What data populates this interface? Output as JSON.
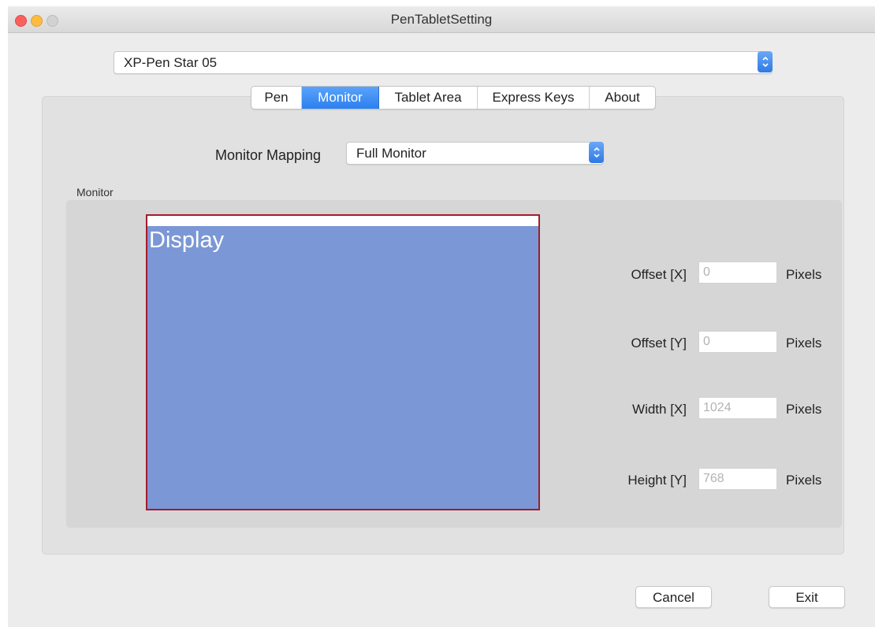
{
  "window": {
    "title": "PenTabletSetting"
  },
  "device": {
    "selected": "XP-Pen Star 05"
  },
  "tabs": [
    {
      "label": "Pen",
      "active": false
    },
    {
      "label": "Monitor",
      "active": true
    },
    {
      "label": "Tablet Area",
      "active": false
    },
    {
      "label": "Express Keys",
      "active": false
    },
    {
      "label": "About",
      "active": false
    }
  ],
  "monitor_mapping": {
    "label": "Monitor Mapping",
    "selected": "Full Monitor"
  },
  "monitor_group": {
    "label": "Monitor",
    "display_label": "Display"
  },
  "fields": [
    {
      "label": "Offset [X]",
      "value": "0",
      "unit": "Pixels"
    },
    {
      "label": "Offset [Y]",
      "value": "0",
      "unit": "Pixels"
    },
    {
      "label": "Width [X]",
      "value": "1024",
      "unit": "Pixels"
    },
    {
      "label": "Height [Y]",
      "value": "768",
      "unit": "Pixels"
    }
  ],
  "buttons": {
    "cancel": "Cancel",
    "exit": "Exit"
  },
  "colors": {
    "accent": "#2b7ff0",
    "display_fill": "#7b97d5",
    "display_border": "#a31c2a"
  }
}
